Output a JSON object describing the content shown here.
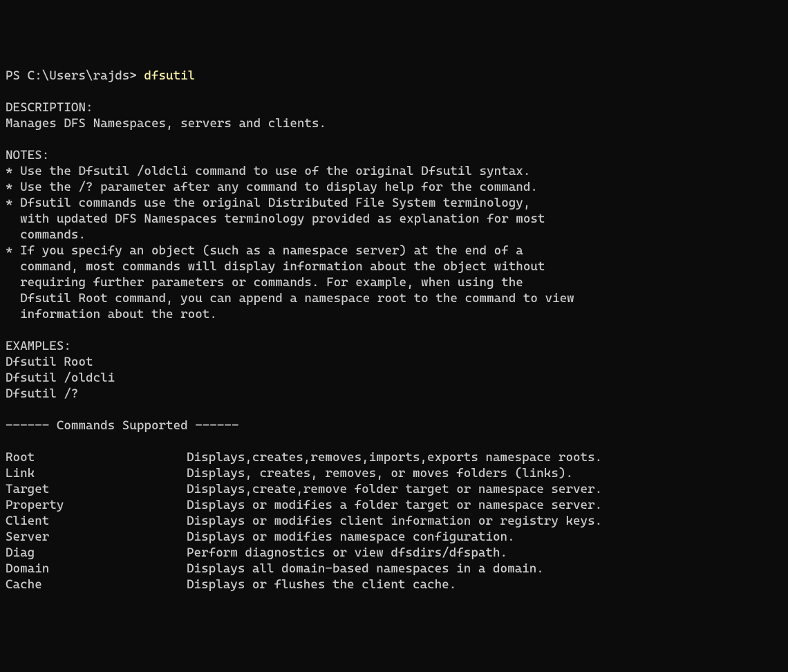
{
  "prompt": "PS C:\\Users\\rajds> ",
  "command": "dfsutil",
  "blank": "",
  "description_header": "DESCRIPTION:",
  "description_text": "Manages DFS Namespaces, servers and clients.",
  "notes_header": "NOTES:",
  "notes": [
    "* Use the Dfsutil /oldcli command to use of the original Dfsutil syntax.",
    "* Use the /? parameter after any command to display help for the command.",
    "* Dfsutil commands use the original Distributed File System terminology,",
    "  with updated DFS Namespaces terminology provided as explanation for most",
    "  commands.",
    "* If you specify an object (such as a namespace server) at the end of a",
    "  command, most commands will display information about the object without",
    "  requiring further parameters or commands. For example, when using the",
    "  Dfsutil Root command, you can append a namespace root to the command to view",
    "  information about the root."
  ],
  "examples_header": "EXAMPLES:",
  "examples": [
    "Dfsutil Root",
    "Dfsutil /oldcli",
    "Dfsutil /?"
  ],
  "commands_header": "------ Commands Supported ------",
  "commands": [
    {
      "name": "Root",
      "desc": "Displays,creates,removes,imports,exports namespace roots."
    },
    {
      "name": "Link",
      "desc": "Displays, creates, removes, or moves folders (links)."
    },
    {
      "name": "Target",
      "desc": "Displays,create,remove folder target or namespace server."
    },
    {
      "name": "Property",
      "desc": "Displays or modifies a folder target or namespace server."
    },
    {
      "name": "Client",
      "desc": "Displays or modifies client information or registry keys."
    },
    {
      "name": "Server",
      "desc": "Displays or modifies namespace configuration."
    },
    {
      "name": "Diag",
      "desc": "Perform diagnostics or view dfsdirs/dfspath."
    },
    {
      "name": "Domain",
      "desc": "Displays all domain-based namespaces in a domain."
    },
    {
      "name": "Cache",
      "desc": "Displays or flushes the client cache."
    }
  ]
}
